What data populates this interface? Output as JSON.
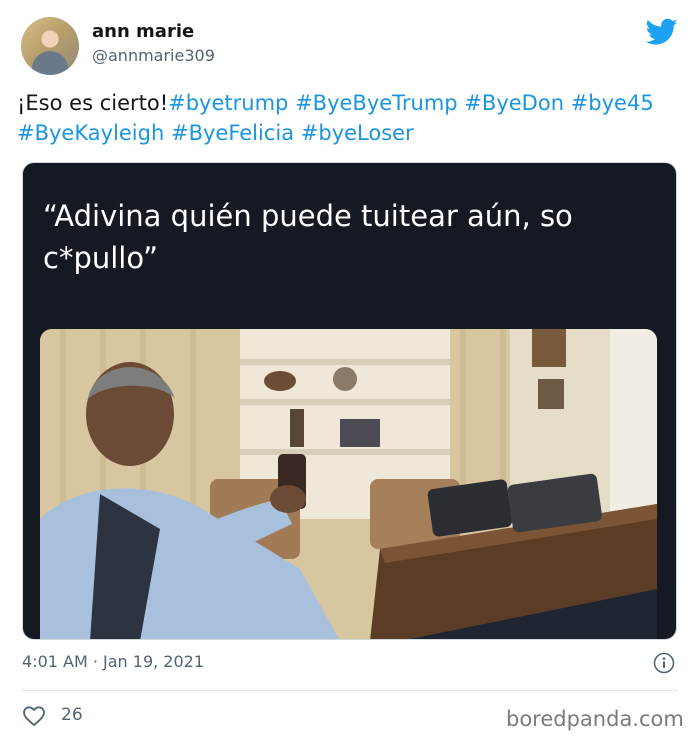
{
  "tweet": {
    "author_name": "ann marie",
    "author_handle": "@annmarie309",
    "text_plain": "¡Eso es cierto!",
    "hashtags": [
      "#byetrump",
      "#ByeByeTrump",
      "#ByeDon",
      "#bye45",
      "#ByeKayleigh",
      "#ByeFelicia",
      "#byeLoser"
    ],
    "media_caption": "“Adivina quién puede tuitear aún, so c*pullo”",
    "timestamp": "4:01 AM · Jan 19, 2021",
    "like_count": "26"
  },
  "watermark": "boredpanda.com",
  "colors": {
    "link": "#1b95e0",
    "twitter_blue": "#1da1f2",
    "card_bg": "#151a22"
  },
  "icons": [
    "twitter-bird-icon",
    "info-icon",
    "heart-icon"
  ]
}
